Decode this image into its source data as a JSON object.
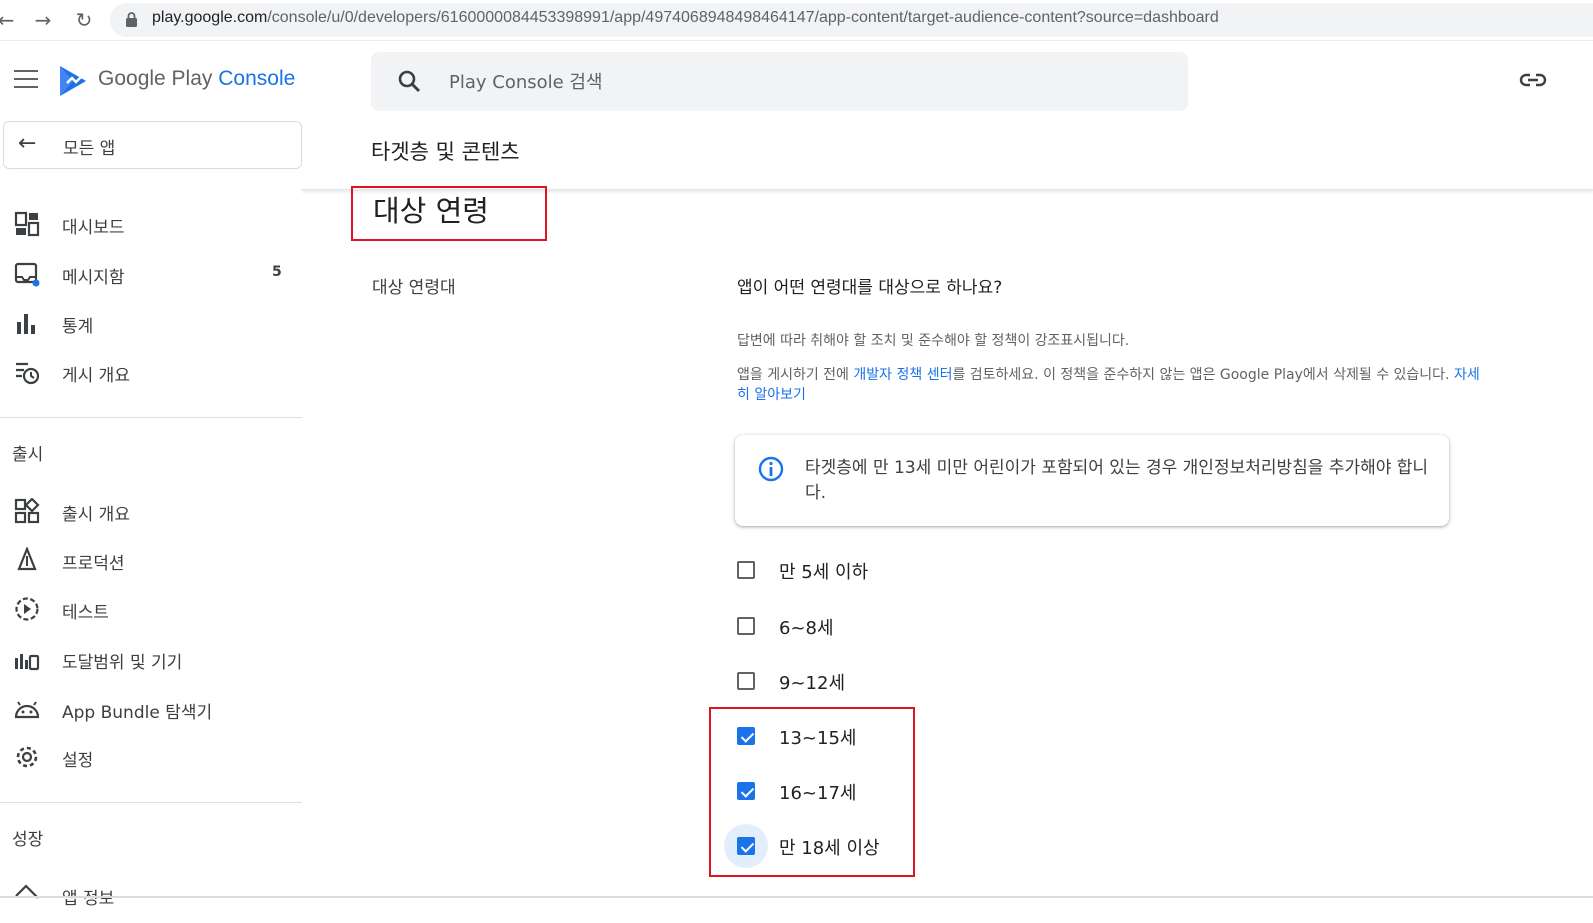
{
  "browser": {
    "url_host": "play.google.com",
    "url_path": "/console/u/0/developers/6160000084453398991/app/4974068948498464147/app-content/target-audience-content?source=dashboard"
  },
  "sidebar": {
    "logo_google_play": "Google Play ",
    "logo_console": "Console",
    "all_apps": "모든 앱",
    "items": [
      {
        "label": "대시보드",
        "icon": "dashboard-icon"
      },
      {
        "label": "메시지함",
        "icon": "inbox-icon",
        "count": "5"
      },
      {
        "label": "통계",
        "icon": "bar-chart-icon"
      },
      {
        "label": "게시 개요",
        "icon": "publishing-overview-icon"
      }
    ],
    "section_release": "출시",
    "release_items": [
      {
        "label": "출시 개요",
        "icon": "release-overview-icon"
      },
      {
        "label": "프로덕션",
        "icon": "production-icon"
      },
      {
        "label": "테스트",
        "icon": "testing-icon"
      },
      {
        "label": "도달범위 및 기기",
        "icon": "reach-devices-icon"
      },
      {
        "label": "App Bundle 탐색기",
        "icon": "android-icon"
      },
      {
        "label": "설정",
        "icon": "settings-gear-icon"
      }
    ],
    "section_grow": "성장",
    "grow_items": [
      {
        "label": "앱 정보",
        "icon": "store-presence-icon"
      }
    ]
  },
  "search": {
    "placeholder": "Play Console 검색"
  },
  "page": {
    "subheader": "타겟층 및 콘텐츠",
    "section_title": "대상 연령",
    "field_label": "대상 연령대",
    "question": "앱이 어떤 연령대를 대상으로 하나요?",
    "desc1": "답변에 따라 취해야 할 조치 및 준수해야 할 정책이 강조표시됩니다.",
    "desc2_a": "앱을 게시하기 전에 ",
    "desc2_link1": "개발자 정책 센터",
    "desc2_b": "를 검토하세요. 이 정책을 준수하지 않는 앱은 Google Play에서 삭제될 수 있습니다. ",
    "desc2_link2": "자세히 알아보기",
    "info_text": "타겟층에 만 13세 미만 어린이가 포함되어 있는 경우 개인정보처리방침을 추가해야 합니다.",
    "age_options": [
      {
        "label": "만 5세 이하",
        "checked": false
      },
      {
        "label": "6~8세",
        "checked": false
      },
      {
        "label": "9~12세",
        "checked": false
      },
      {
        "label": "13~15세",
        "checked": true
      },
      {
        "label": "16~17세",
        "checked": true
      },
      {
        "label": "만 18세 이상",
        "checked": true
      }
    ]
  },
  "colors": {
    "accent": "#1a73e8",
    "highlight_box": "#e0141e"
  }
}
